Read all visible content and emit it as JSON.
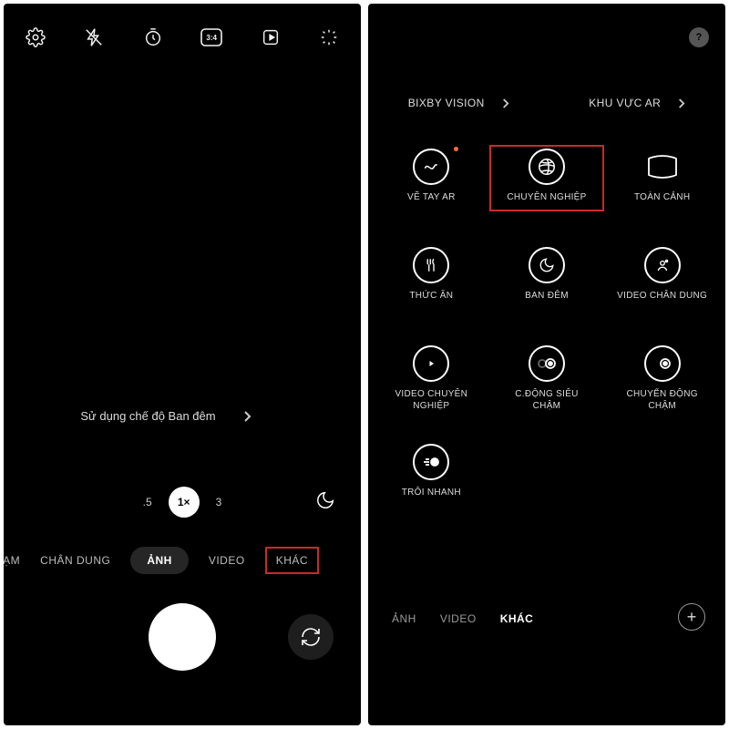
{
  "left": {
    "top_icons": [
      "settings",
      "flash-off",
      "timer",
      "ratio-3-4",
      "motion-photo",
      "filters"
    ],
    "night_hint": "Sử dụng chế độ Ban đêm",
    "zoom": {
      "wide": ".5",
      "one": "1×",
      "tele": "3"
    },
    "modes": {
      "m0": "HẠM",
      "m1": "CHÂN DUNG",
      "m2": "ẢNH",
      "m3": "VIDEO",
      "m4": "KHÁC"
    }
  },
  "right": {
    "top": {
      "link1": "BIXBY VISION",
      "link2": "KHU VỰC AR"
    },
    "grid": {
      "c0": "VẼ TAY AR",
      "c1": "CHUYÊN NGHIỆP",
      "c2": "TOÀN CẢNH",
      "c3": "THỨC ĂN",
      "c4": "BAN ĐÊM",
      "c5": "VIDEO CHÂN DUNG",
      "c6": "VIDEO CHUYÊN NGHIỆP",
      "c7": "C.ĐỘNG SIÊU CHẬM",
      "c8": "CHUYỂN ĐỘNG CHẬM",
      "c9": "TRÔI NHANH"
    },
    "modes": {
      "m0": "ẢNH",
      "m1": "VIDEO",
      "m2": "KHÁC"
    },
    "ratio_label": "3:4"
  }
}
